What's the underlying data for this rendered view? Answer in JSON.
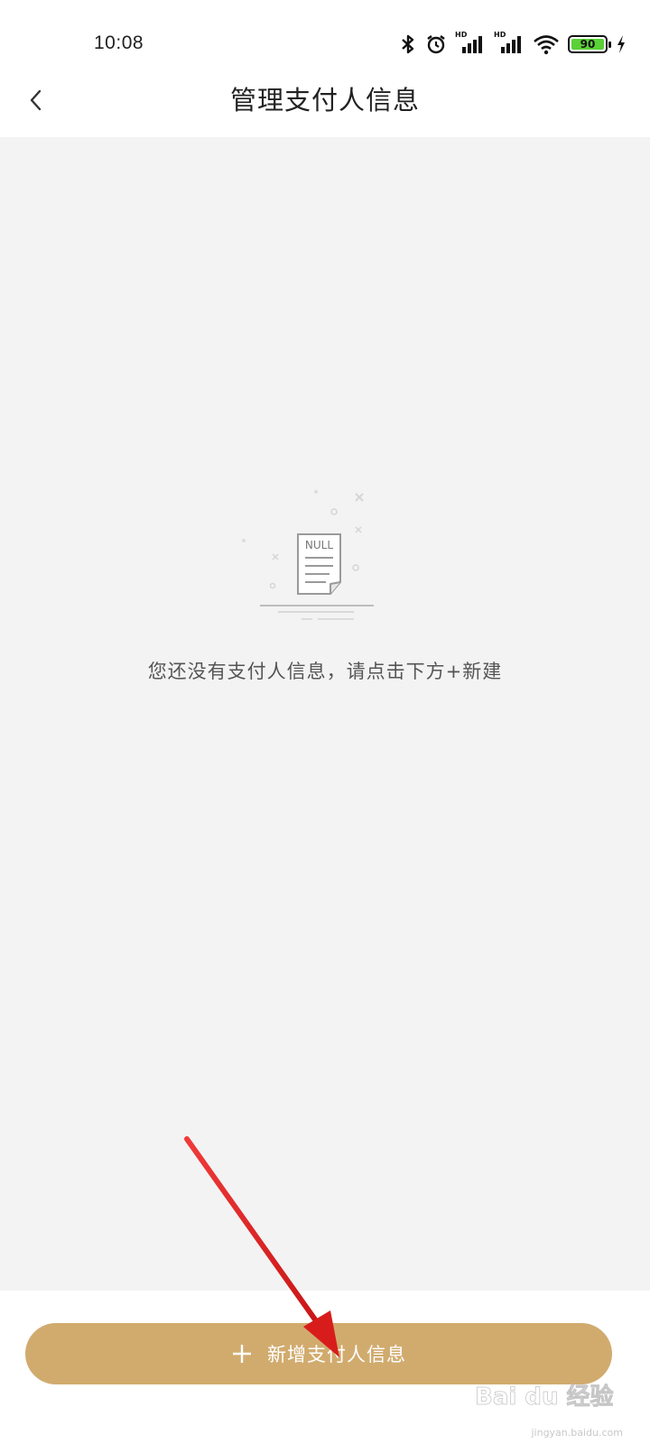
{
  "status_bar": {
    "time": "10:08",
    "battery_level": "90",
    "signal_1_label": "HD",
    "signal_2_label": "HD",
    "icons": [
      "bluetooth-icon",
      "alarm-icon",
      "signal-icon",
      "signal-icon",
      "wifi-icon",
      "battery-icon",
      "charging-icon"
    ]
  },
  "header": {
    "title": "管理支付人信息",
    "back_icon": "chevron-left-icon"
  },
  "empty_state": {
    "document_label": "NULL",
    "message": "您还没有支付人信息，请点击下方+新建"
  },
  "footer": {
    "add_button_label": "新增支付人信息",
    "add_icon": "plus-icon"
  },
  "watermark": {
    "brand": "Bai du 经验",
    "sub": "jingyan.baidu.com"
  },
  "colors": {
    "accent": "#d1ab6e",
    "content_background": "#f3f3f3",
    "annotation_arrow": "#e02020"
  }
}
